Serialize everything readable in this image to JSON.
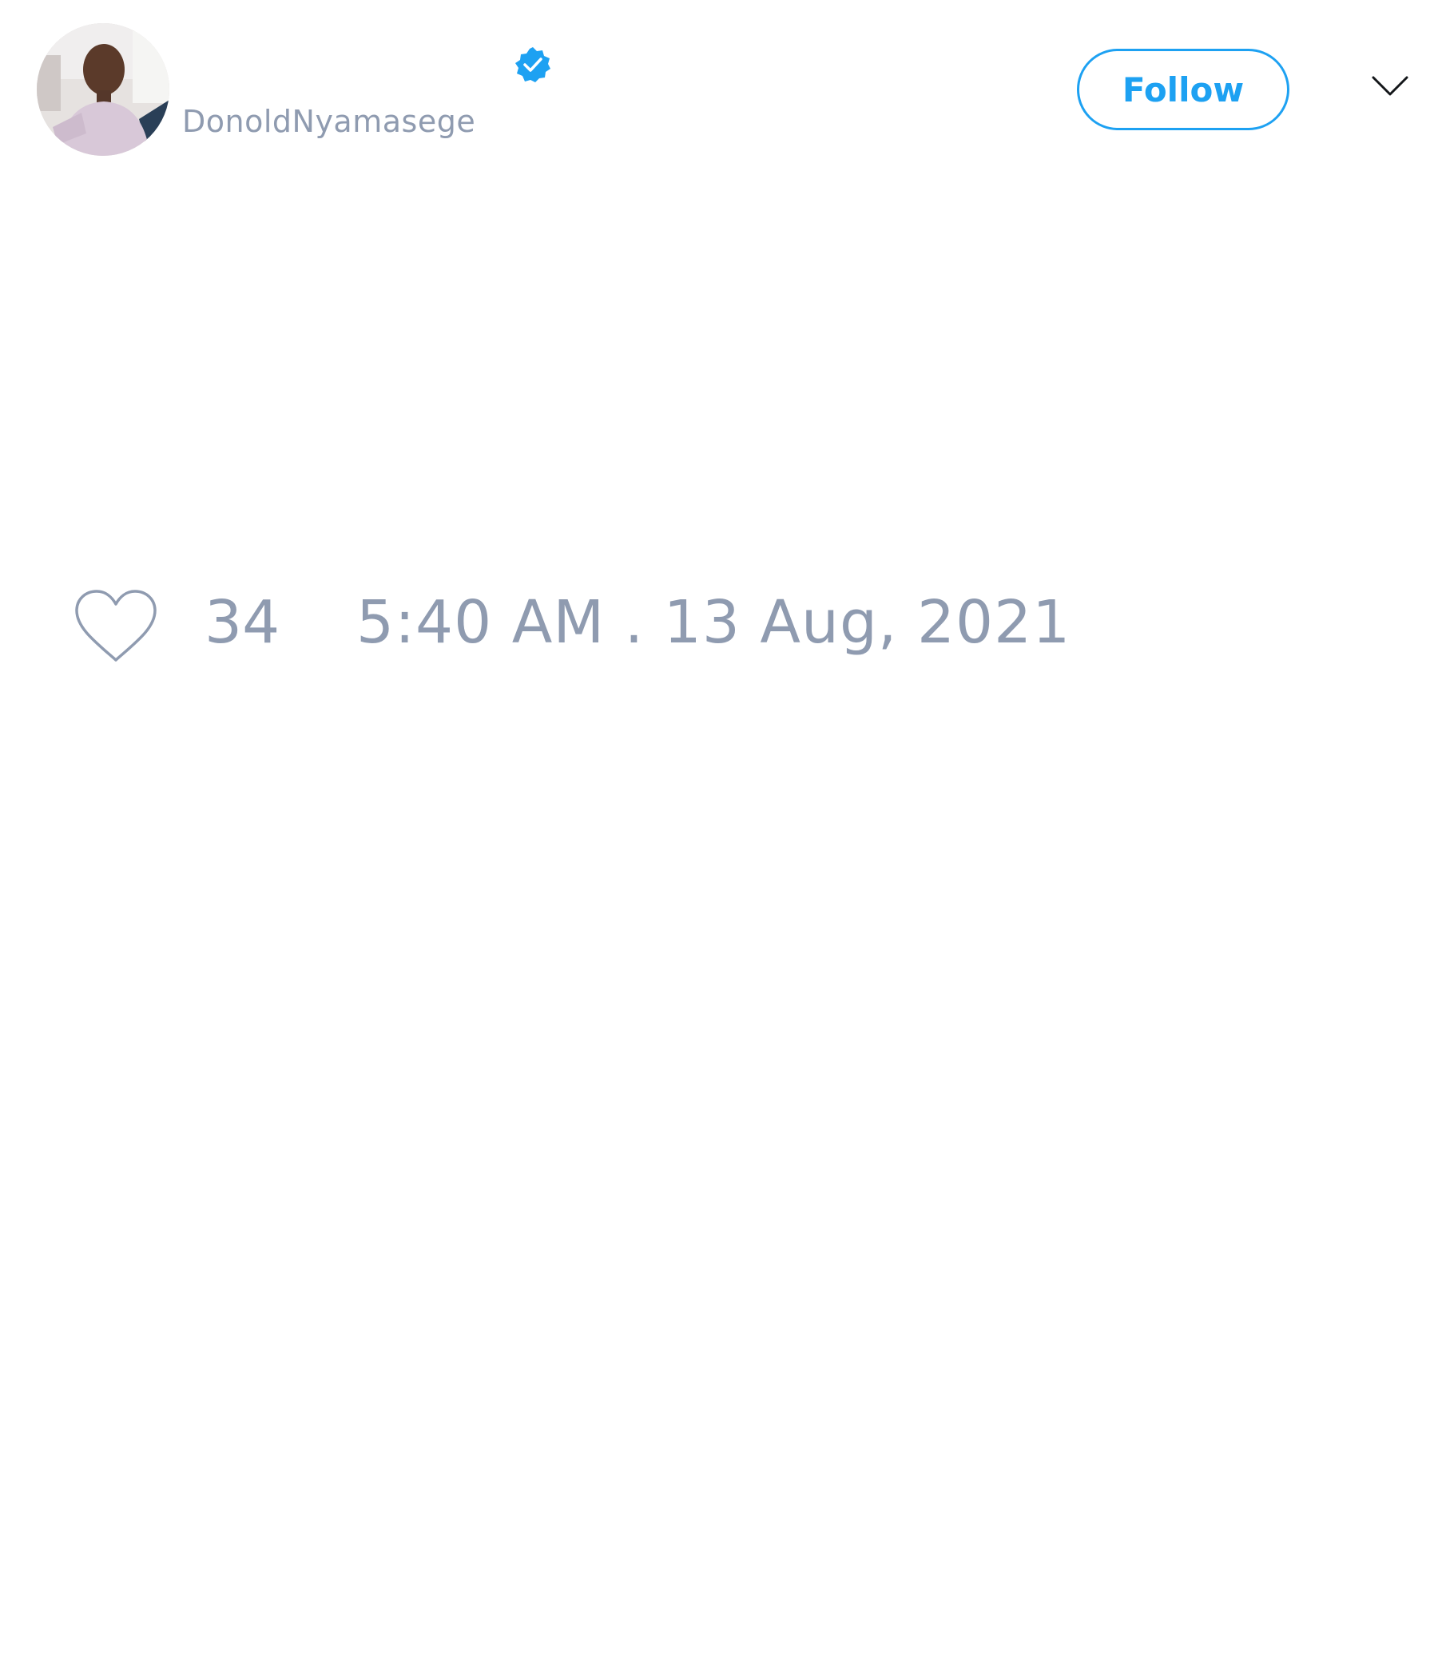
{
  "tweet": {
    "author": {
      "display_name": "",
      "handle": "DonoldNyamasege",
      "verified": true,
      "avatar_icon": "profile-photo",
      "verified_icon": "verified-badge-icon"
    },
    "actions": {
      "follow_label": "Follow",
      "menu_icon": "chevron-down-icon"
    },
    "footer": {
      "like_icon": "heart-icon",
      "like_count": "34",
      "timestamp": "5:40 AM . 13 Aug, 2021"
    }
  },
  "colors": {
    "accent": "#1da1f2",
    "muted_text": "#8f9bb0",
    "background": "#ffffff",
    "chevron": "#14171a"
  }
}
